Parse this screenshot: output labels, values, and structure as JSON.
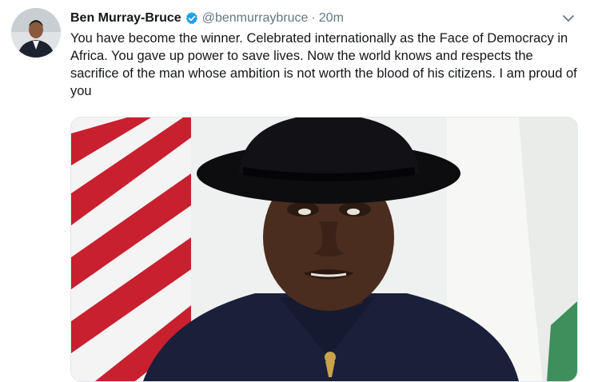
{
  "tweet": {
    "display_name": "Ben Murray-Bruce",
    "handle": "@benmurraybruce",
    "separator": "·",
    "time": "20m",
    "text": "You have become the winner. Celebrated internationally as the Face of Democracy in Africa. You gave up power to save lives. Now the world knows and respects the sacrifice of the man whose ambition is not worth the blood of his citizens. I am proud of you"
  },
  "icons": {
    "verified": "verified-badge-icon",
    "caret": "chevron-down-icon"
  },
  "colors": {
    "verified_blue": "#1da1f2",
    "muted": "#657786",
    "text": "#14171a"
  }
}
